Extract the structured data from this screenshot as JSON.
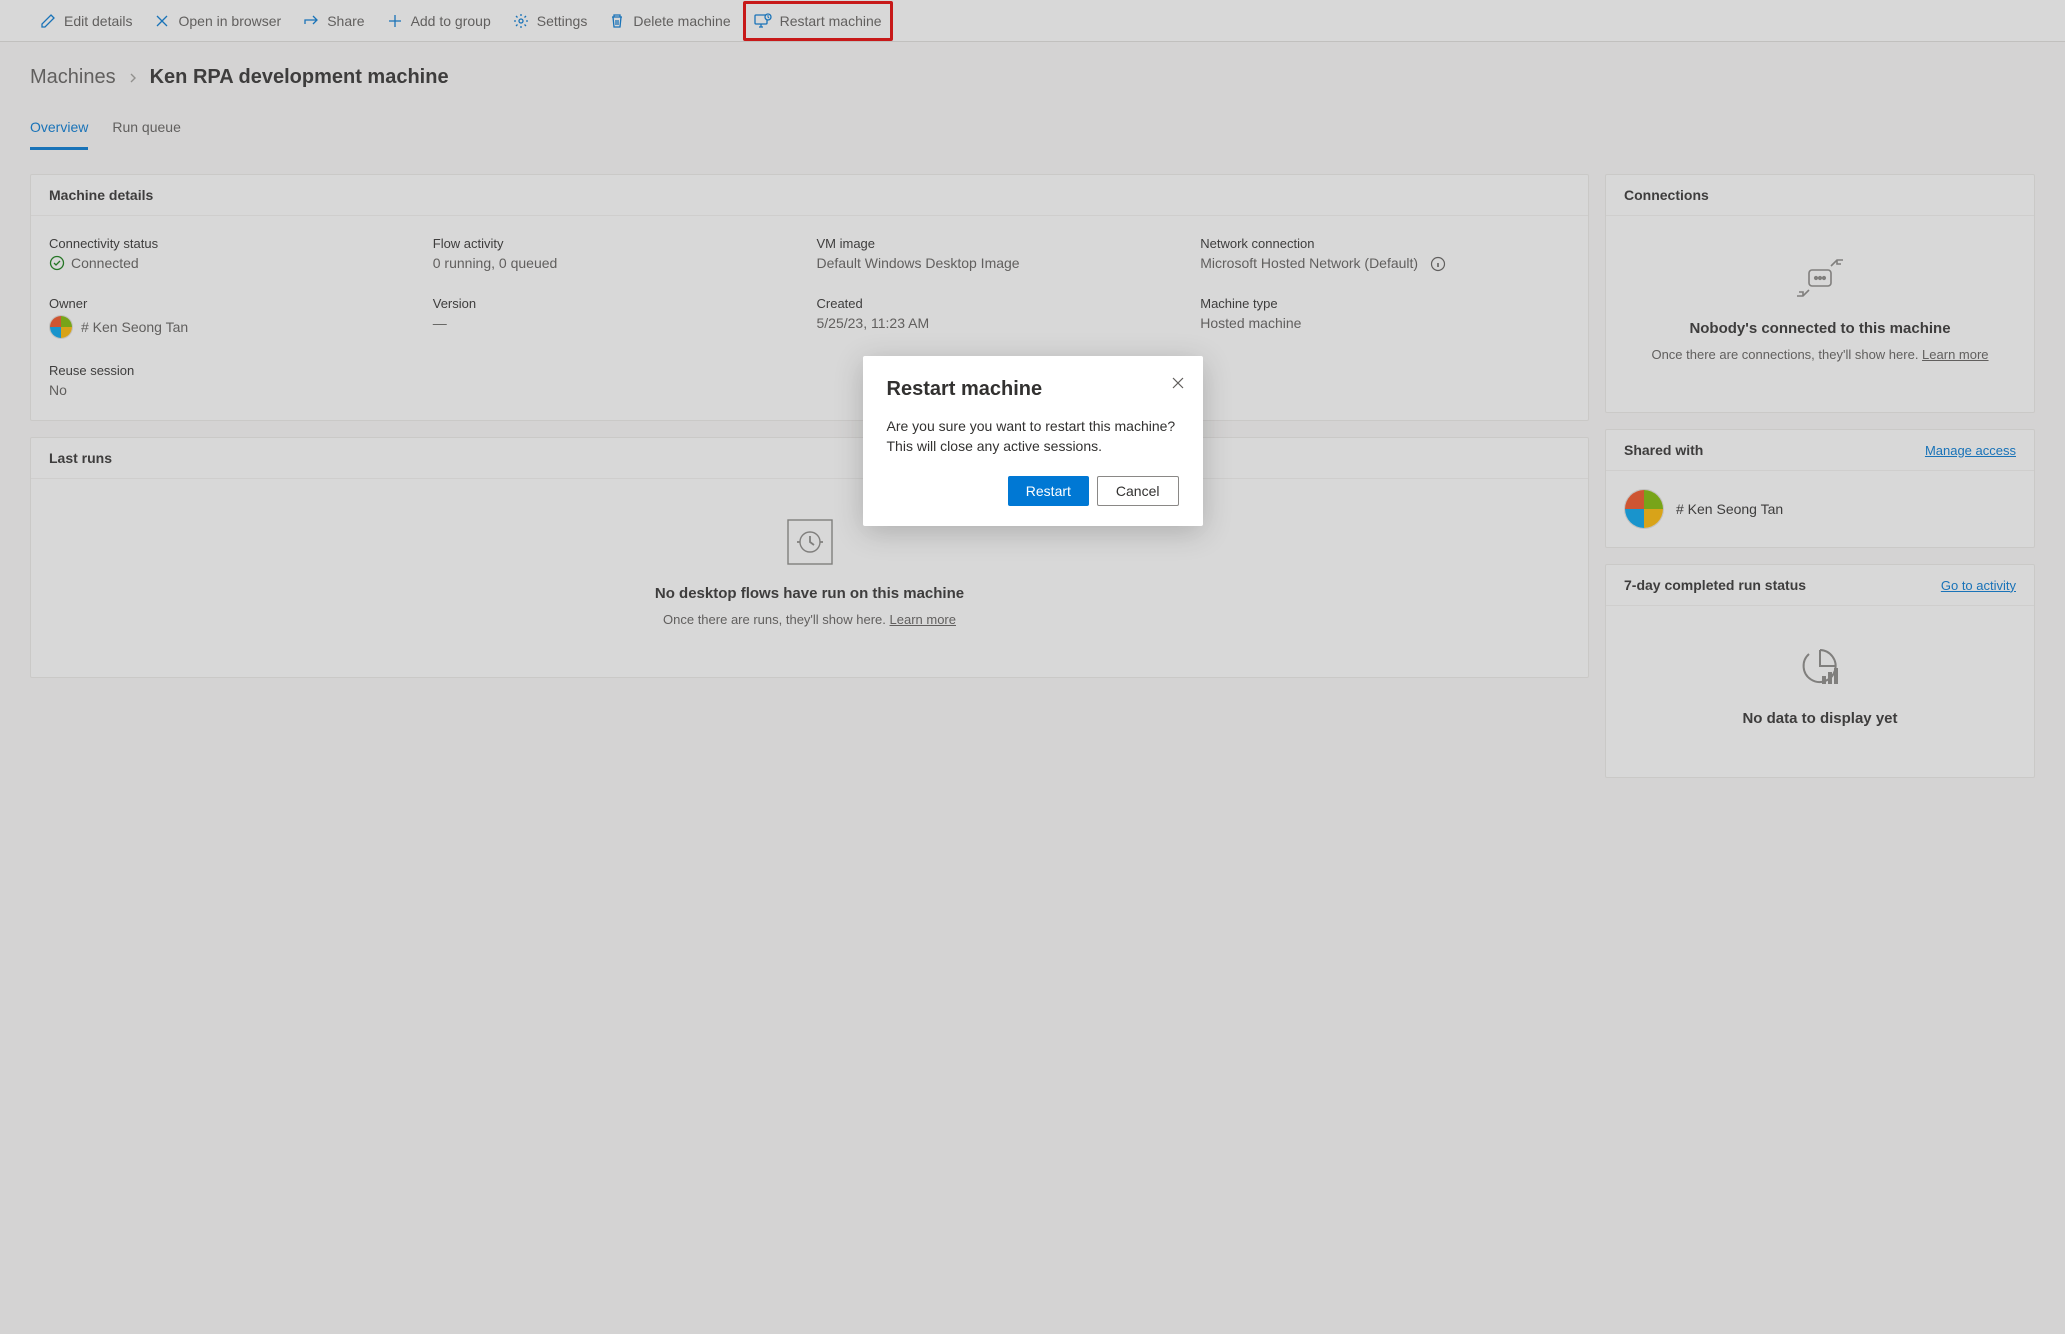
{
  "toolbar": {
    "edit": "Edit details",
    "open": "Open in browser",
    "share": "Share",
    "add": "Add to group",
    "settings": "Settings",
    "delete": "Delete machine",
    "restart": "Restart machine"
  },
  "breadcrumb": {
    "root": "Machines",
    "current": "Ken RPA development machine"
  },
  "tabs": {
    "overview": "Overview",
    "runqueue": "Run queue"
  },
  "details": {
    "header": "Machine details",
    "connectivity_label": "Connectivity status",
    "connectivity_value": "Connected",
    "flow_label": "Flow activity",
    "flow_value": "0 running, 0 queued",
    "vm_label": "VM image",
    "vm_value": "Default Windows Desktop Image",
    "net_label": "Network connection",
    "net_value": "Microsoft Hosted Network (Default)",
    "owner_label": "Owner",
    "owner_value": "# Ken Seong Tan",
    "version_label": "Version",
    "version_value": "—",
    "created_label": "Created",
    "created_value": "5/25/23, 11:23 AM",
    "type_label": "Machine type",
    "type_value": "Hosted machine",
    "reuse_label": "Reuse session",
    "reuse_value": "No"
  },
  "lastruns": {
    "header": "Last runs",
    "empty_title": "No desktop flows have run on this machine",
    "empty_sub": "Once there are runs, they'll show here. ",
    "empty_link": "Learn more"
  },
  "connections": {
    "header": "Connections",
    "empty_title": "Nobody's connected to this machine",
    "empty_sub": "Once there are connections, they'll show here. ",
    "empty_link": "Learn more"
  },
  "shared": {
    "header": "Shared with",
    "manage": "Manage access",
    "user": "# Ken Seong Tan"
  },
  "runstatus": {
    "header": "7-day completed run status",
    "link": "Go to activity",
    "empty_title": "No data to display yet"
  },
  "modal": {
    "title": "Restart machine",
    "body": "Are you sure you want to restart this machine? This will close any active sessions.",
    "confirm": "Restart",
    "cancel": "Cancel"
  }
}
